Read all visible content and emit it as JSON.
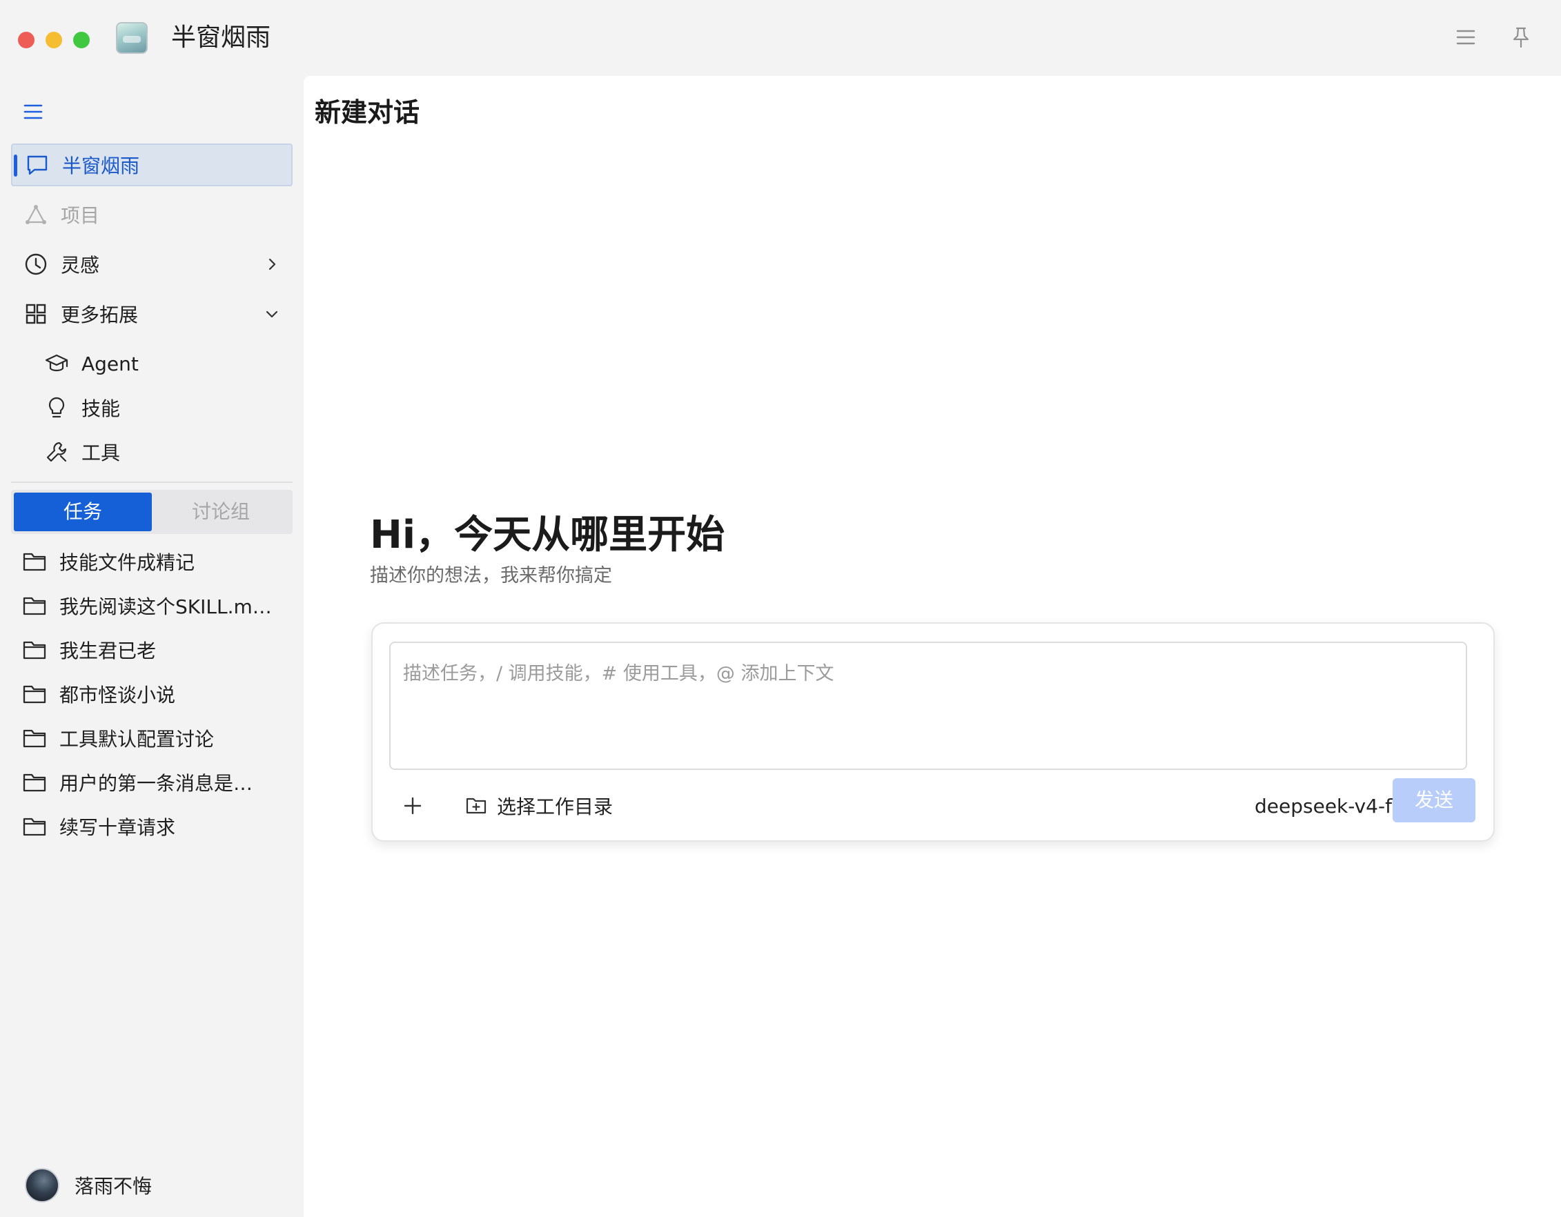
{
  "app": {
    "title": "半窗烟雨"
  },
  "sidebar": {
    "nav": [
      {
        "label": "半窗烟雨",
        "icon": "chat-icon",
        "state": "active"
      },
      {
        "label": "项目",
        "icon": "triangle-nodes-icon",
        "state": "disabled"
      },
      {
        "label": "灵感",
        "icon": "clock-icon",
        "state": "collapsed"
      },
      {
        "label": "更多拓展",
        "icon": "grid-icon",
        "state": "expanded"
      }
    ],
    "more_items": [
      {
        "label": "Agent",
        "icon": "graduation-cap-icon"
      },
      {
        "label": "技能",
        "icon": "lightbulb-icon"
      },
      {
        "label": "工具",
        "icon": "wrench-icon"
      }
    ],
    "tabs": {
      "active": "任务",
      "inactive": "讨论组"
    },
    "tasks": [
      "技能文件成精记",
      "我先阅读这个SKILL.m…",
      "我生君已老",
      "都市怪谈小说",
      "工具默认配置讨论",
      "用户的第一条消息是…",
      "续写十章请求"
    ],
    "user": {
      "name": "落雨不悔"
    }
  },
  "main": {
    "page_title": "新建对话",
    "hero_title": "Hi，今天从哪里开始",
    "hero_subtitle": "描述你的想法，我来帮你搞定",
    "composer": {
      "placeholder": "描述任务，/ 调用技能，# 使用工具，@ 添加上下文",
      "select_dir_label": "选择工作目录",
      "model": "deepseek-v4-fl…",
      "send_label": "发送"
    }
  },
  "colors": {
    "accent": "#1560d6",
    "send_disabled": "#b8cdfa",
    "active_bg": "#dbe3ef"
  }
}
